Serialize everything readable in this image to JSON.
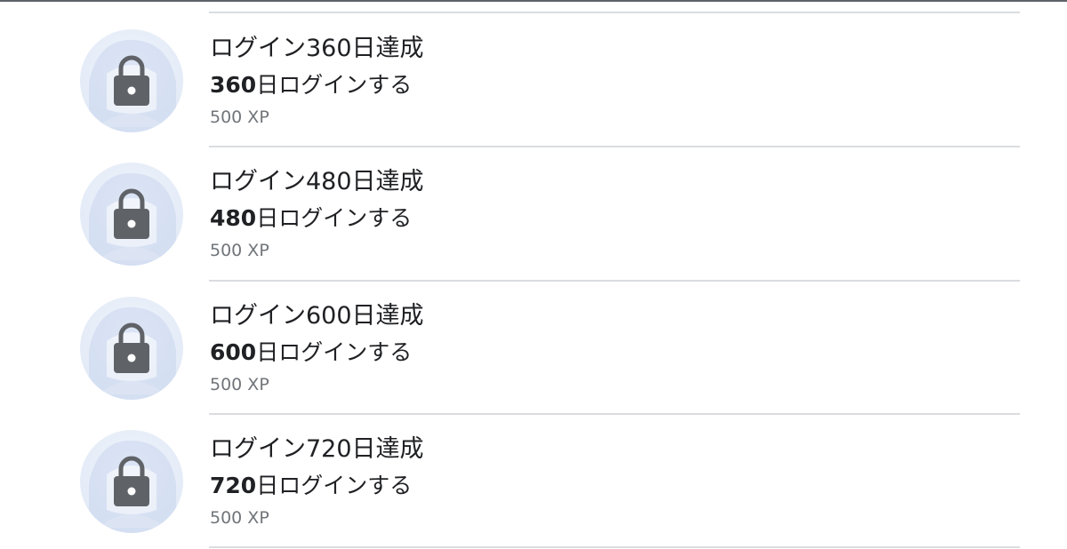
{
  "achievements": [
    {
      "title": "ログイン360日達成",
      "description_num": "360",
      "description_rest": "日ログインする",
      "xp": "500 XP",
      "icon": "lock-icon"
    },
    {
      "title": "ログイン480日達成",
      "description_num": "480",
      "description_rest": "日ログインする",
      "xp": "500 XP",
      "icon": "lock-icon"
    },
    {
      "title": "ログイン600日達成",
      "description_num": "600",
      "description_rest": "日ログインする",
      "xp": "500 XP",
      "icon": "lock-icon"
    },
    {
      "title": "ログイン720日達成",
      "description_num": "720",
      "description_rest": "日ログインする",
      "xp": "500 XP",
      "icon": "lock-icon"
    }
  ],
  "colors": {
    "lock": "#5f6368",
    "divider": "#dadce0",
    "text_primary": "#202124",
    "text_secondary": "#70757a"
  }
}
